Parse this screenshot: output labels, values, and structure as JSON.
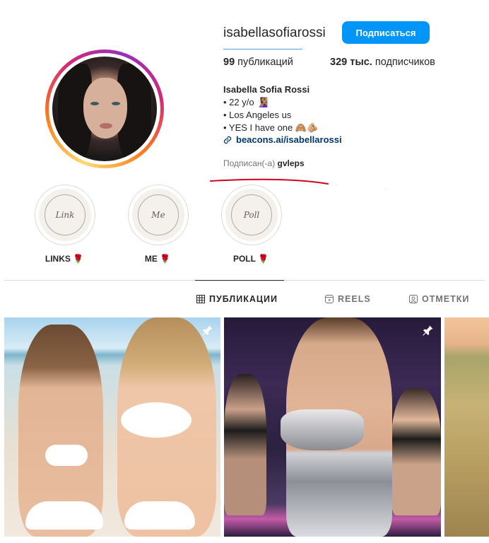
{
  "profile": {
    "username": "isabellasofiarossi",
    "follow_label": "Подписаться",
    "posts_count": "99",
    "posts_label": "публикаций",
    "followers_count": "329 тыс.",
    "followers_label": "подписчиков",
    "name": "Isabella Sofia Rossi",
    "bio": [
      "• 22 y/o 🧏🏽‍♀️",
      "• Los Angeles us",
      "• YES I have one 🙈🫵🏼"
    ],
    "link": "beacons.ai/isabellarossi",
    "followed_by_label": "Подписан(-а)",
    "followed_by_user": "gvleps"
  },
  "highlights": [
    {
      "label": "LINKS 🌹",
      "cover": "Link"
    },
    {
      "label": "ME 🌹",
      "cover": "Me"
    },
    {
      "label": "POLL 🌹",
      "cover": "Poll"
    }
  ],
  "tabs": [
    {
      "label": "ПУБЛИКАЦИИ",
      "icon": "grid-icon",
      "active": true
    },
    {
      "label": "REELS",
      "icon": "reels-icon",
      "active": false
    },
    {
      "label": "ОТМЕТКИ",
      "icon": "tagged-icon",
      "active": false
    }
  ],
  "posts": [
    {
      "pinned": true,
      "desc": "beach-photo"
    },
    {
      "pinned": true,
      "desc": "club-photo"
    },
    {
      "pinned": false,
      "desc": "field-photo"
    }
  ],
  "colors": {
    "accent": "#0095f6",
    "link": "#00376b",
    "annotation": "#d0021b"
  }
}
